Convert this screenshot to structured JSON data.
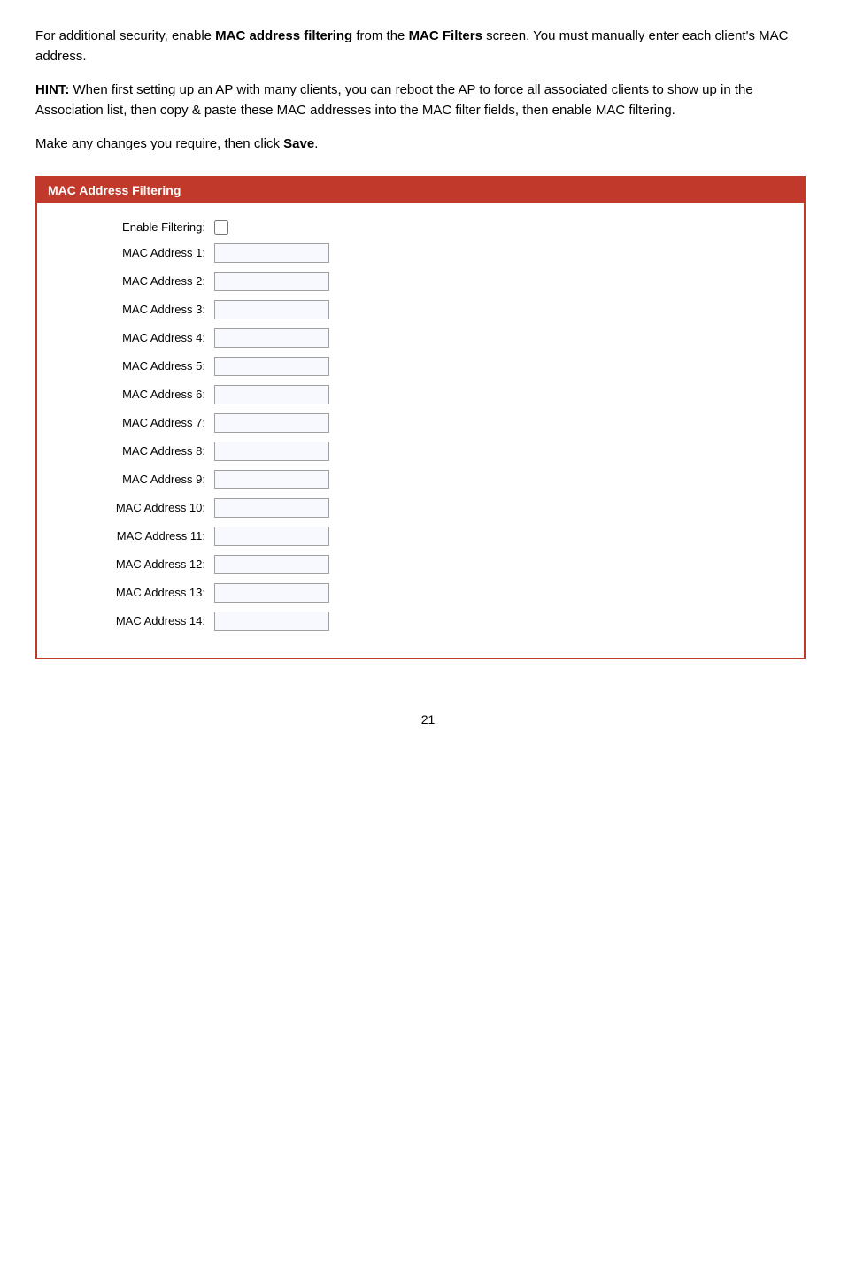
{
  "intro": {
    "text_before_bold1": "For additional security, enable ",
    "bold1": "MAC address filtering",
    "text_middle": " from the ",
    "bold2": "MAC Filters",
    "text_after": " screen.  You must manually enter each client’s MAC address."
  },
  "hint": {
    "label": "HINT:",
    "text": " When first setting up an AP with many clients, you can reboot the AP to force all associated clients to show up in the Association list, then copy & paste these MAC addresses into the MAC filter fields, then enable MAC filtering."
  },
  "action": {
    "text_before": "Make any changes you require, then click ",
    "bold": "Save",
    "text_after": "."
  },
  "form": {
    "title": "MAC Address Filtering",
    "enable_label": "Enable Filtering:",
    "mac_addresses": [
      "MAC Address 1:",
      "MAC Address 2:",
      "MAC Address 3:",
      "MAC Address 4:",
      "MAC Address 5:",
      "MAC Address 6:",
      "MAC Address 7:",
      "MAC Address 8:",
      "MAC Address 9:",
      "MAC Address 10:",
      "MAC Address 11:",
      "MAC Address 12:",
      "MAC Address 13:",
      "MAC Address 14:"
    ]
  },
  "page_number": "21"
}
